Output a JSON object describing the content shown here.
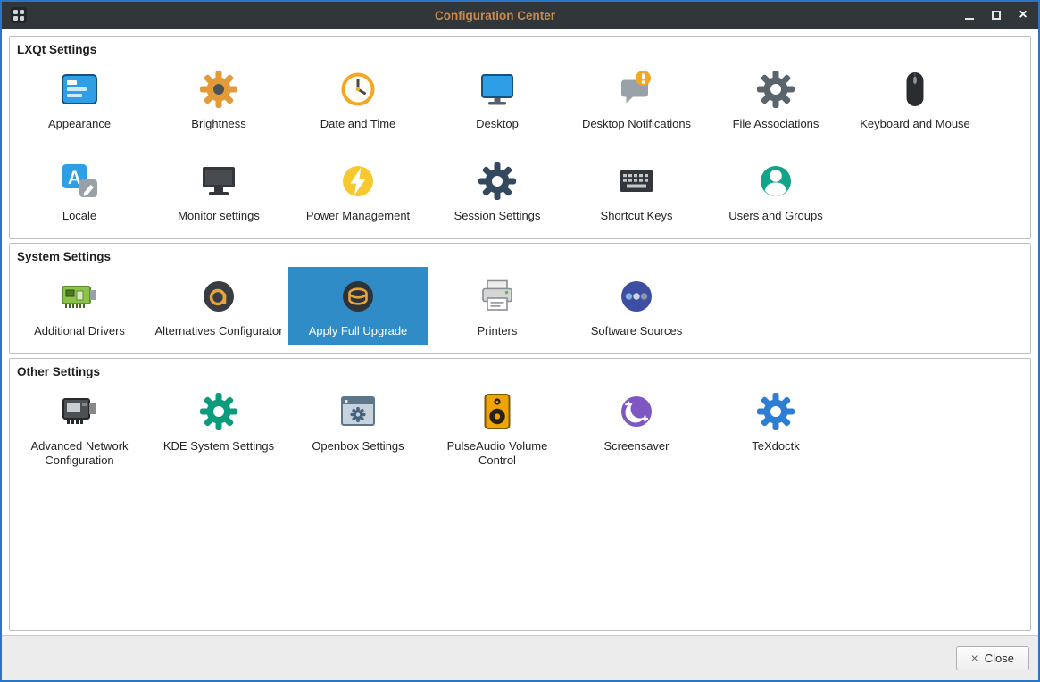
{
  "window": {
    "title": "Configuration Center",
    "controls": [
      {
        "name": "minimize",
        "glyph": "–"
      },
      {
        "name": "maximize",
        "glyph": "❐"
      },
      {
        "name": "close",
        "glyph": "×"
      }
    ]
  },
  "colors": {
    "window_border": "#2d74c4",
    "titlebar": "#31363b",
    "title_text": "#c98a4e",
    "selection": "#308cc6",
    "selection_text": "#ffffff"
  },
  "sections": [
    {
      "title": "LXQt Settings",
      "items": [
        {
          "label": "Appearance",
          "icon": "appearance"
        },
        {
          "label": "Brightness",
          "icon": "brightness"
        },
        {
          "label": "Date and Time",
          "icon": "date-time"
        },
        {
          "label": "Desktop",
          "icon": "desktop"
        },
        {
          "label": "Desktop Notifications",
          "icon": "desktop-notifications"
        },
        {
          "label": "File Associations",
          "icon": "file-associations"
        },
        {
          "label": "Keyboard and Mouse",
          "icon": "keyboard-mouse"
        },
        {
          "label": "Locale",
          "icon": "locale"
        },
        {
          "label": "Monitor settings",
          "icon": "monitor-settings"
        },
        {
          "label": "Power Management",
          "icon": "power-management"
        },
        {
          "label": "Session Settings",
          "icon": "session-settings"
        },
        {
          "label": "Shortcut Keys",
          "icon": "shortcut-keys"
        },
        {
          "label": "Users and Groups",
          "icon": "users-groups"
        }
      ]
    },
    {
      "title": "System Settings",
      "items": [
        {
          "label": "Additional Drivers",
          "icon": "additional-drivers"
        },
        {
          "label": "Alternatives Configurator",
          "icon": "alternatives-configurator"
        },
        {
          "label": "Apply Full Upgrade",
          "icon": "apply-full-upgrade",
          "selected": true
        },
        {
          "label": "Printers",
          "icon": "printers"
        },
        {
          "label": "Software Sources",
          "icon": "software-sources"
        }
      ]
    },
    {
      "title": "Other Settings",
      "items": [
        {
          "label": "Advanced Network Configuration",
          "icon": "advanced-network-configuration"
        },
        {
          "label": "KDE System Settings",
          "icon": "kde-system-settings"
        },
        {
          "label": "Openbox Settings",
          "icon": "openbox-settings"
        },
        {
          "label": "PulseAudio Volume Control",
          "icon": "pulseaudio-volume-control"
        },
        {
          "label": "Screensaver",
          "icon": "screensaver"
        },
        {
          "label": "TeXdoctk",
          "icon": "texdoctk"
        }
      ]
    }
  ],
  "footer": {
    "close_label": "Close",
    "close_icon": "×"
  }
}
